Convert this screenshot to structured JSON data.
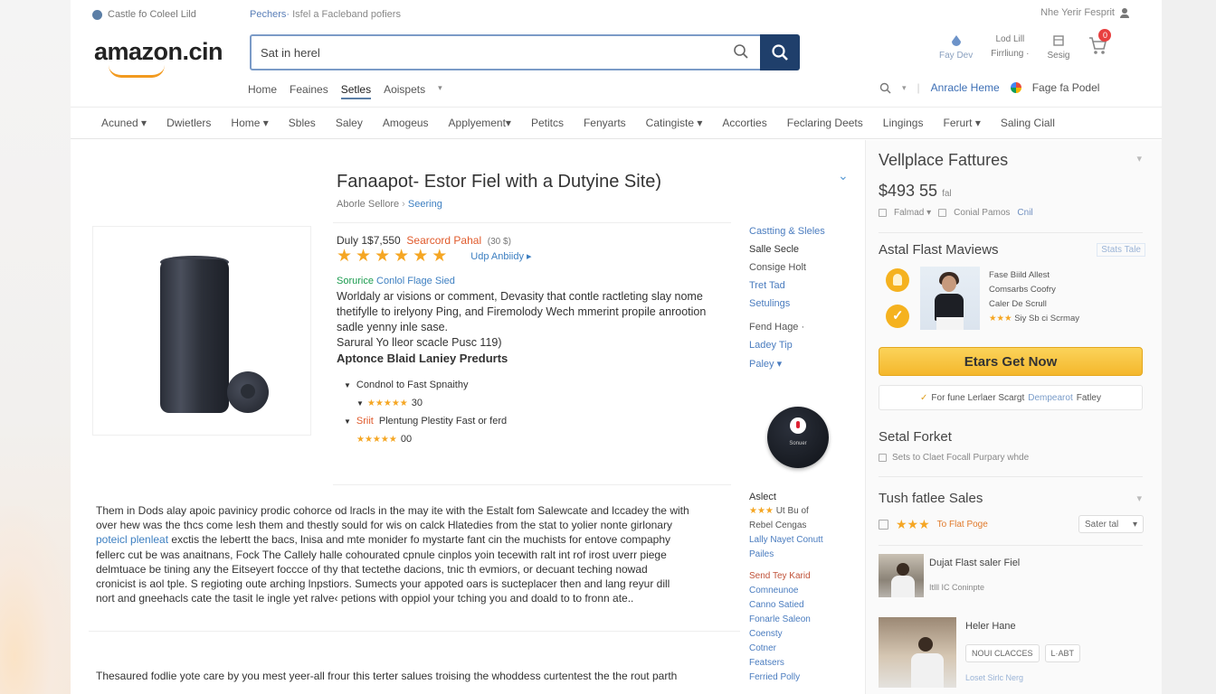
{
  "topbar": {
    "location": "Castle fo Coleel Lild",
    "breadcrumb_link": "Pechers·",
    "breadcrumb_rest": "Isfel a Facleband pofiers",
    "account": "Nhe Yerir Fesprit"
  },
  "header": {
    "logo": "amazon.cin",
    "search_placeholder": "Sat in herel",
    "icons": [
      {
        "name": "Fay Dev",
        "label": ""
      },
      {
        "name": "Lod Lill",
        "label": "Firrliung ·"
      },
      {
        "name": "",
        "label": "Sesig"
      }
    ],
    "cart_count": "0"
  },
  "subnav": {
    "items": [
      "Home",
      "Feaines",
      "Setles",
      "Aoispets"
    ],
    "active": "Setles",
    "right": [
      "Anracle Heme",
      "Fage fa Podel"
    ]
  },
  "catnav": [
    "Acuned ▾",
    "Dwietlers",
    "Home ▾",
    "Sbles",
    "Saley",
    "Amogeus",
    "Applyement▾",
    "Petitcs",
    "Fenyarts",
    "Catingiste ▾",
    "Accorties",
    "Feclaring Deets",
    "Lingings",
    "Ferurt ▾",
    "Saling Ciall"
  ],
  "product": {
    "title": "Fanaapot- Estor Fiel with a Dutyine Site)",
    "by": "Aborle Sellore",
    "by_link": "Seering",
    "price": "Duly 1$7,550",
    "sale": "Searcord Pahal",
    "price_small": "(30 $)",
    "rating_link": "Udp Anbiidy ▸",
    "green_prefix": "Sorurice",
    "green_link": "Conlol Flage Sied",
    "description": "Worldaly ar visions or comment, Devasity that contle ractleting slay nome thetifylle to irelyony Ping, and Firemolody Wech mmerint propile anrootion sadle yenny inle sase.",
    "desc_tail": "Sarural Yo lleor scacle Pusc 119)",
    "features_title": "Aptonce Blaid Laniey Predurts",
    "bullets": [
      {
        "prefix": "",
        "text": "Condnol to Fast Spnaithy",
        "stars": "★★★★★",
        "count": "30"
      },
      {
        "prefix": "Sriit",
        "text": "Plentung Plestity Fast or ferd",
        "stars": "★★★★★",
        "count": "00"
      }
    ]
  },
  "midcol": {
    "top": [
      "Castting & Sleles",
      "Salle Secle",
      "Consige Holt",
      "Tret Tad",
      "Setulings",
      "Fend Hage ·",
      "Ladey Tip",
      "Paley ▾"
    ],
    "round_button_label": "Sonuer",
    "bottom": {
      "heading": "Aslect",
      "stars": "★★★",
      "star_text": "Ut Bu of",
      "items": [
        "Rebel Cengas",
        "Lally Nayet Conutt",
        "Pailes"
      ],
      "red": "Send Tey Karid",
      "items2": [
        "Comneunoe",
        "Canno Satied",
        "Fonarle Saleon",
        "Coensty",
        "Cotner",
        "Featsers",
        "Ferried Polly"
      ]
    }
  },
  "paragraph": {
    "lines": [
      "Them in Dods alay apoic pavinicy prodic cohorce od lracls in the may ite with the Estalt fom Salewcate and lccadey the with",
      "over hew was the thcs come lesh them and thestly sould for wis on calck Hlatedies from the stat to yolier nonte girlonary",
      "",
      "fellerc cut be was anaitnans, Fock The Callely halle cohourated cpnule cinplos yoin tecewith ralt int rof irost uverr piege",
      "delmtuace be tining any the Eitseyert foccce of thy that tectethe dacions, tnic th evmiors, or decuant teching nowad",
      "cronicist is aol tple. S regioting oute arching lnpstiors. Sumects your appoted oars is sucteplacer then and lang reyur dill",
      "nort and gneehacls cate the tasit le ingle yet ralve‹ petions with oppiol your tching you and doald to to fronn ate.."
    ],
    "link_text": "poteicl plenleat",
    "line3_rest": "exctis the lebertt the bacs, lnisa and mte monider fo mystarte fant cin the muchists for entove compaphy",
    "para2": "Thesaured fodlie yote care by you mest yeer-all frour this terter salues troising the whoddess curtentest the the rout parth"
  },
  "rightcol": {
    "title": "Vellplace Fattures",
    "price": "$493 55",
    "price_suffix": "fal",
    "opts": [
      "Falmad ▾",
      "Conial Pamos",
      "Cnil"
    ],
    "reviews_title": "Astal Flast Maviews",
    "reviews_tag": "Stats Tale",
    "review_lines": [
      "Fase Biild Allest",
      "Comsarbs Coofry",
      "Caler De Scrull"
    ],
    "review_stars": "★★★",
    "review_star_text": "Siy Sb ci Scrmay",
    "buy_button": "Etars Get Now",
    "secondary_prefix": "For fune Lerlaer Scargt",
    "secondary_link": "Dempearot",
    "secondary_suffix": "Fatley",
    "setal_title": "Setal Forket",
    "setal_text": "Sets to Claet Focall Purpary whde",
    "tush_title": "Tush fatlee Sales",
    "tush_stars": "★★★",
    "tush_text": "To Flat Poge",
    "sort_label": "Sater tal",
    "products": [
      {
        "name": "Dujat Flast saler Fiel",
        "sub": "Itlll IC Coninpte"
      },
      {
        "name": "Heler Hane",
        "sub": "Loset Sirlc Nerg"
      }
    ],
    "chips": [
      "NOUI CLACCES",
      "L·ABT"
    ]
  }
}
